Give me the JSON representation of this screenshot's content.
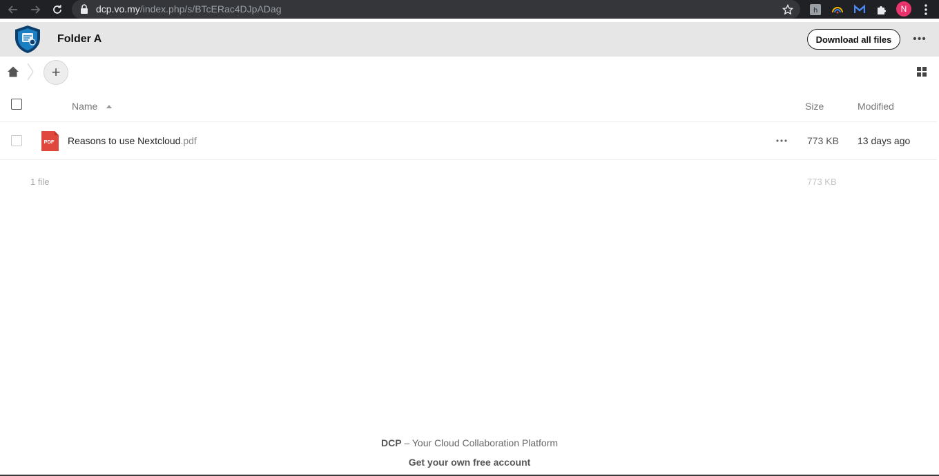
{
  "browser": {
    "url_host": "dcp.vo.my",
    "url_path": "/index.php/s/BTcERac4DJpADag",
    "profile_initial": "N"
  },
  "header": {
    "title": "Folder A",
    "download_all_label": "Download all files",
    "more_label": "•••"
  },
  "breadcrumb": {
    "add_label": "+"
  },
  "table": {
    "columns": {
      "name": "Name",
      "size": "Size",
      "modified": "Modified"
    },
    "rows": [
      {
        "basename": "Reasons to use Nextcloud",
        "extension": ".pdf",
        "icon_label": "PDF",
        "size": "773 KB",
        "modified": "13 days ago"
      }
    ],
    "summary": {
      "count": "1 file",
      "total_size": "773 KB"
    }
  },
  "footer": {
    "brand": "DCP",
    "tagline": " – Your Cloud Collaboration Platform",
    "link": "Get your own free account"
  },
  "colors": {
    "pdf_red": "#e0483e",
    "logo_blue": "#1b7fc4",
    "avatar_pink": "#e8336d"
  }
}
